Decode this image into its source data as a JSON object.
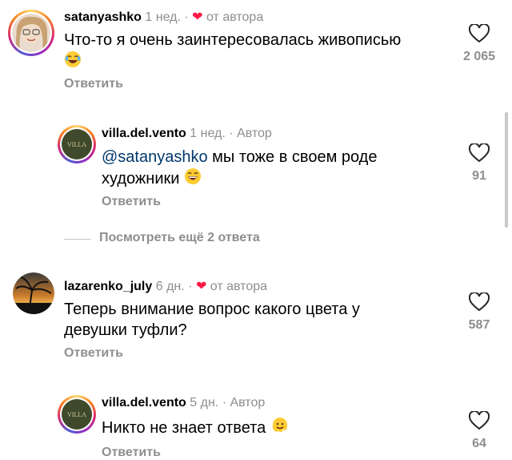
{
  "comments": [
    {
      "username": "satanyashko",
      "time": "1 нед.",
      "sep": "·",
      "heart": "❤",
      "badge": "от автора",
      "text": "Что-то я очень заинтересовалась живописью",
      "emoji": "😂",
      "reply_label": "Ответить",
      "likes": "2 065"
    },
    {
      "username": "villa.del.vento",
      "time": "1 нед.",
      "sep": "·",
      "badge": "Автор",
      "mention": "@satanyashko",
      "text": " мы тоже в своем роде",
      "text2": "художники",
      "emoji": "😄",
      "reply_label": "Ответить",
      "likes": "91",
      "avatar_text": "VILLA"
    },
    {
      "username": "lazarenko_july",
      "time": "6 дн.",
      "sep": "·",
      "heart": "❤",
      "badge": "от автора",
      "text": "Теперь внимание вопрос какого цвета у",
      "text2": "девушки туфли?",
      "reply_label": "Ответить",
      "likes": "587"
    },
    {
      "username": "villa.del.vento",
      "time": "5 дн.",
      "sep": "·",
      "badge": "Автор",
      "text": "Никто не знает ответа",
      "emoji": "🫠",
      "reply_label": "Ответить",
      "likes": "64",
      "avatar_text": "VILLA"
    }
  ],
  "more_replies": "Посмотреть ещё 2 ответа",
  "colors": {
    "heart": "#ff1744",
    "mention": "#00376b",
    "muted": "#8e8e8e",
    "avatar_green": "#3f4a2c"
  }
}
